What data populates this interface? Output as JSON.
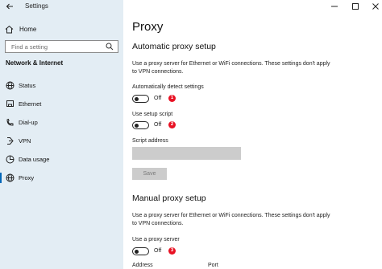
{
  "app": {
    "title": "Settings"
  },
  "sidebar": {
    "home_label": "Home",
    "search_placeholder": "Find a setting",
    "section_title": "Network & Internet",
    "items": [
      {
        "label": "Status",
        "icon": "globe-icon"
      },
      {
        "label": "Ethernet",
        "icon": "ethernet-icon"
      },
      {
        "label": "Dial-up",
        "icon": "phone-icon"
      },
      {
        "label": "VPN",
        "icon": "vpn-icon"
      },
      {
        "label": "Data usage",
        "icon": "data-usage-icon"
      },
      {
        "label": "Proxy",
        "icon": "globe-icon",
        "selected": true
      }
    ]
  },
  "main": {
    "title": "Proxy",
    "auto": {
      "heading": "Automatic proxy setup",
      "description": "Use a proxy server for Ethernet or WiFi connections. These settings don't apply to VPN connections.",
      "detect_label": "Automatically detect settings",
      "detect_state": "Off",
      "detect_badge": "1",
      "script_label": "Use setup script",
      "script_state": "Off",
      "script_badge": "2",
      "address_label": "Script address",
      "save_label": "Save"
    },
    "manual": {
      "heading": "Manual proxy setup",
      "description": "Use a proxy server for Ethernet or WiFi connections. These settings don't apply to VPN connections.",
      "use_label": "Use a proxy server",
      "use_state": "Off",
      "use_badge": "3",
      "address_col": "Address",
      "port_col": "Port"
    }
  },
  "colors": {
    "accent": "#0067b8",
    "sidebar_bg": "#e3edf4",
    "badge": "#e81123"
  }
}
